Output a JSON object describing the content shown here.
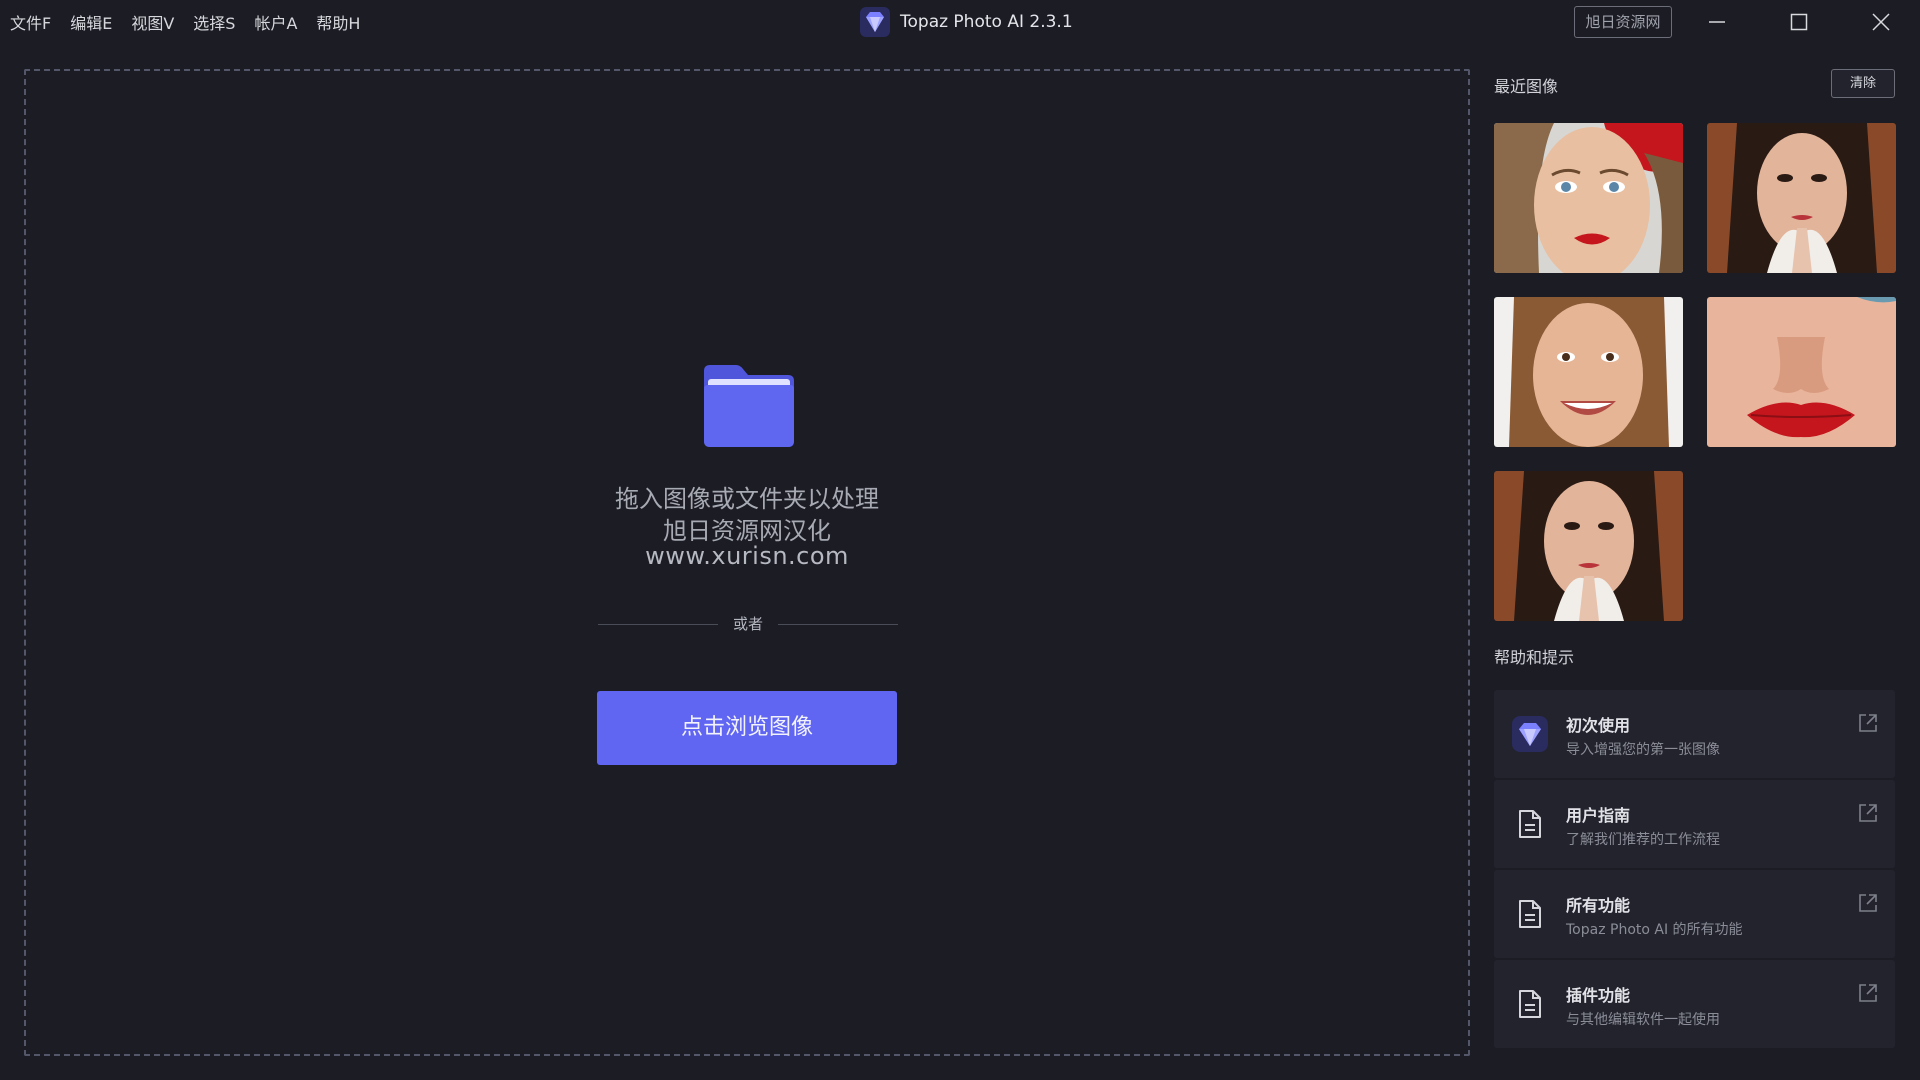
{
  "menu": [
    "文件F",
    "编辑E",
    "视图V",
    "选择S",
    "帐户A",
    "帮助H"
  ],
  "app": {
    "title": "Topaz Photo AI 2.3.1",
    "site_button": "旭日资源网"
  },
  "dropzone": {
    "line1": "拖入图像或文件夹以处理",
    "line2": "旭日资源网汉化",
    "url": "www.xurisn.com",
    "or": "或者",
    "browse_button": "点击浏览图像"
  },
  "recent": {
    "title": "最近图像",
    "clear_button": "清除",
    "thumbnails": [
      "woman-red-beret-photo",
      "woman-hands-lace-photo",
      "smiling-woman-photo",
      "red-lips-closeup-photo",
      "woman-hands-lace-photo-2"
    ]
  },
  "help": {
    "title": "帮助和提示",
    "cards": [
      {
        "title": "初次使用",
        "subtitle": "导入增强您的第一张图像",
        "icon": "topaz-logo-icon"
      },
      {
        "title": "用户指南",
        "subtitle": "了解我们推荐的工作流程",
        "icon": "document-icon"
      },
      {
        "title": "所有功能",
        "subtitle": "Topaz Photo AI 的所有功能",
        "icon": "document-icon"
      },
      {
        "title": "插件功能",
        "subtitle": "与其他编辑软件一起使用",
        "icon": "document-icon"
      }
    ]
  },
  "colors": {
    "background": "#1b1c24",
    "accent": "#6166f2",
    "card": "#22232d",
    "folder": "#5f66f0"
  }
}
